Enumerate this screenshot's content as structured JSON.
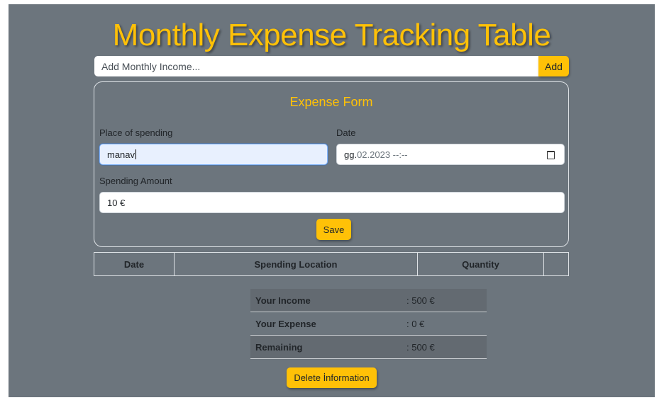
{
  "title": "Monthly Expense Tracking Table",
  "income": {
    "placeholder": "Add Monthly Income...",
    "add_label": "Add"
  },
  "form": {
    "title": "Expense Form",
    "place_label": "Place of spending",
    "place_value": "manav",
    "date_label": "Date",
    "date_value_day": "gg.",
    "date_value_rest": "02.2023 --:--",
    "amount_label": "Spending Amount",
    "amount_value": "10 €",
    "save_label": "Save"
  },
  "table": {
    "headers": [
      "Date",
      "Spending Location",
      "Quantity",
      ""
    ]
  },
  "summary": {
    "rows": [
      {
        "label": "Your Income",
        "value": ": 500 €"
      },
      {
        "label": "Your Expense",
        "value": ": 0 €"
      },
      {
        "label": "Remaining",
        "value": ": 500 €"
      }
    ]
  },
  "delete_label": "Delete İnformation",
  "colors": {
    "background": "#6c757d",
    "accent": "#ffc107"
  },
  "icons": {
    "date_picker": "calendar-icon"
  }
}
